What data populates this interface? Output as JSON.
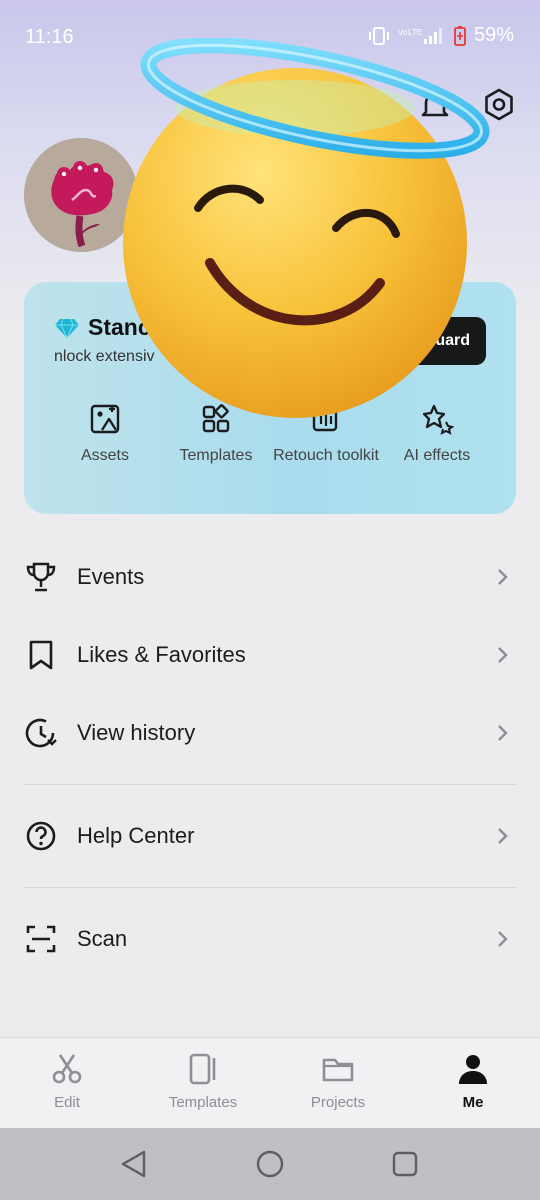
{
  "status": {
    "time": "11:16",
    "battery": "59%"
  },
  "header": {
    "notification_icon": "bell-icon",
    "settings_icon": "gear-icon"
  },
  "plan_card": {
    "title": "Stanc",
    "subtitle": "nlock extensiv",
    "upgrade_label": "uard",
    "accent": "#1fb6d6",
    "tools": [
      {
        "label": "Assets",
        "icon": "image-shapes-icon"
      },
      {
        "label": "Templates",
        "icon": "grid-icon"
      },
      {
        "label": "Retouch toolkit",
        "icon": "retouch-icon"
      },
      {
        "label": "AI effects",
        "icon": "sparkle-icon"
      }
    ]
  },
  "menu": {
    "items": [
      {
        "label": "Events",
        "icon": "trophy-icon"
      },
      {
        "label": "Likes & Favorites",
        "icon": "bookmark-icon"
      },
      {
        "label": "View history",
        "icon": "history-icon"
      },
      {
        "label": "Help Center",
        "icon": "help-icon"
      },
      {
        "label": "Scan",
        "icon": "scan-icon"
      }
    ]
  },
  "tab_bar": {
    "tabs": [
      {
        "label": "Edit",
        "icon": "scissors-icon"
      },
      {
        "label": "Templates",
        "icon": "template-icon"
      },
      {
        "label": "Projects",
        "icon": "folder-icon"
      },
      {
        "label": "Me",
        "icon": "person-icon"
      }
    ],
    "active": "Me"
  },
  "overlay": {
    "emoji": "smiling-face-with-halo"
  }
}
